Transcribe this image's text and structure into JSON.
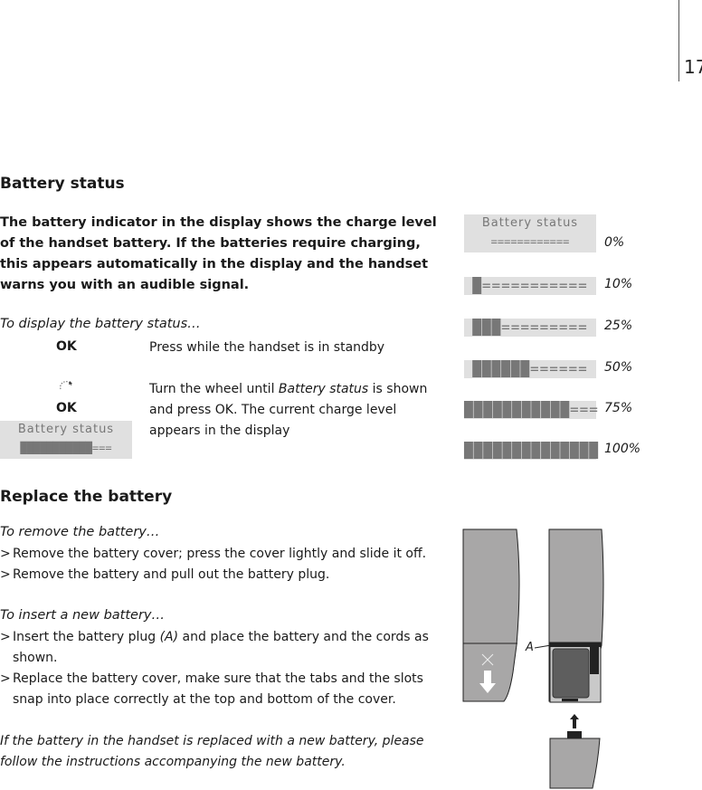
{
  "page_number": "17",
  "battery_status": {
    "heading": "Battery status",
    "intro": "The battery indicator in the display shows the charge level of the handset battery. If the batteries require charging, this appears automatically in the display and the handset warns you with an audible signal.",
    "display_heading": "To display the battery status…",
    "steps": [
      {
        "key": "OK",
        "text": "Press while the handset is in standby"
      },
      {
        "key": "OK",
        "icon": "wheel-icon",
        "text_pre": "Turn the wheel until ",
        "text_em": "Battery status",
        "text_post": " is shown and press OK. The current charge level appears in the display"
      }
    ],
    "example_display": {
      "title": "Battery status",
      "bar": "███████████==="
    },
    "levels": [
      {
        "title": "Battery status",
        "bar": "============",
        "label": "0%"
      },
      {
        "bar": "█===========",
        "label": "10%"
      },
      {
        "bar": "███=========",
        "label": "25%"
      },
      {
        "bar": "██████======",
        "label": "50%"
      },
      {
        "bar": "███████████===",
        "label": "75%"
      },
      {
        "bar": "██████████████",
        "label": "100%"
      }
    ]
  },
  "replace": {
    "heading": "Replace the battery",
    "remove_heading": "To remove the battery…",
    "remove_steps": [
      "Remove the battery cover; press the cover lightly and slide it off.",
      "Remove the battery and pull out the battery plug."
    ],
    "insert_heading": "To insert a new battery…",
    "insert_steps": [
      {
        "pre": "Insert the battery plug ",
        "em": "(A)",
        "post": " and place the battery and the cords as shown."
      },
      {
        "pre": "Replace the battery cover, make sure that the tabs and the slots snap into place correctly at the top and bottom of the cover."
      }
    ],
    "note": "If the battery in the handset is replaced with a new battery, please follow the instructions accompanying the new battery.",
    "figure_label": "A"
  }
}
